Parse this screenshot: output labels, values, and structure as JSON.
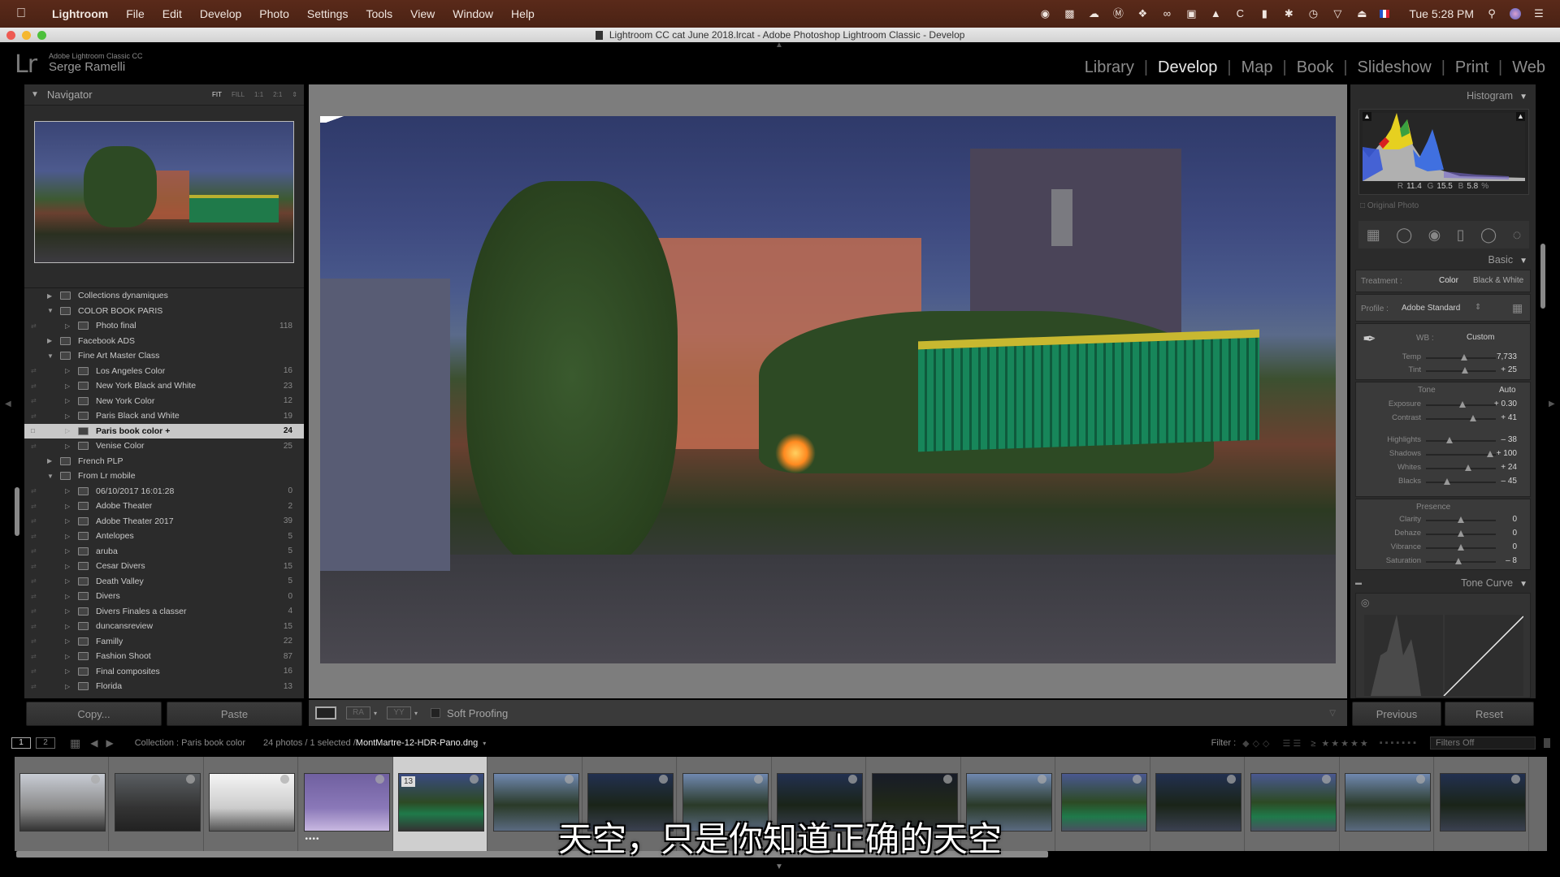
{
  "menubar": {
    "app_name": "Lightroom",
    "items": [
      "File",
      "Edit",
      "Develop",
      "Photo",
      "Settings",
      "Tools",
      "View",
      "Window",
      "Help"
    ],
    "clock": "Tue 5:28 PM",
    "status_icons": [
      "evernote-icon",
      "video-icon",
      "cloud-upload-icon",
      "1password-icon",
      "dropbox-icon",
      "creative-cloud-icon",
      "screen-icon",
      "flame-icon",
      "c-app-icon",
      "battery-icon",
      "bluetooth-icon",
      "time-machine-icon",
      "wifi-icon",
      "eject-icon",
      "flag-icon"
    ]
  },
  "window": {
    "title": "Lightroom CC cat June 2018.lrcat - Adobe Photoshop Lightroom Classic - Develop"
  },
  "identity": {
    "logo": "Lr",
    "product": "Adobe Lightroom Classic CC",
    "user": "Serge Ramelli"
  },
  "modules": {
    "items": [
      "Library",
      "Develop",
      "Map",
      "Book",
      "Slideshow",
      "Print",
      "Web"
    ],
    "active": "Develop"
  },
  "navigator": {
    "title": "Navigator",
    "zoom_options": [
      "FIT",
      "FILL",
      "1:1",
      "2:1"
    ],
    "selected_zoom": "FIT"
  },
  "collections": [
    {
      "name": "Collections dynamiques",
      "level": 0,
      "expanded": false,
      "count": ""
    },
    {
      "name": "COLOR BOOK PARIS",
      "level": 0,
      "expanded": true,
      "count": ""
    },
    {
      "name": "Photo final",
      "level": 1,
      "count": "118"
    },
    {
      "name": "Facebook ADS",
      "level": 0,
      "expanded": false,
      "count": ""
    },
    {
      "name": "Fine Art Master Class",
      "level": 0,
      "expanded": true,
      "count": ""
    },
    {
      "name": "Los Angeles Color",
      "level": 1,
      "count": "16"
    },
    {
      "name": "New York Black and White",
      "level": 1,
      "count": "23"
    },
    {
      "name": "New York Color",
      "level": 1,
      "count": "12"
    },
    {
      "name": "Paris Black and White",
      "level": 1,
      "count": "19"
    },
    {
      "name": "Paris book color  +",
      "level": 1,
      "count": "24",
      "selected": true
    },
    {
      "name": "Venise Color",
      "level": 1,
      "count": "25"
    },
    {
      "name": "French PLP",
      "level": 0,
      "expanded": false,
      "count": ""
    },
    {
      "name": "From Lr mobile",
      "level": 0,
      "expanded": true,
      "count": ""
    },
    {
      "name": "06/10/2017 16:01:28",
      "level": 1,
      "count": "0"
    },
    {
      "name": "Adobe Theater",
      "level": 1,
      "count": "2"
    },
    {
      "name": "Adobe Theater 2017",
      "level": 1,
      "count": "39"
    },
    {
      "name": "Antelopes",
      "level": 1,
      "count": "5"
    },
    {
      "name": "aruba",
      "level": 1,
      "count": "5"
    },
    {
      "name": "Cesar Divers",
      "level": 1,
      "count": "15"
    },
    {
      "name": "Death Valley",
      "level": 1,
      "count": "5"
    },
    {
      "name": "Divers",
      "level": 1,
      "count": "0"
    },
    {
      "name": "Divers Finales a classer",
      "level": 1,
      "count": "4"
    },
    {
      "name": "duncansreview",
      "level": 1,
      "count": "15"
    },
    {
      "name": "Familly",
      "level": 1,
      "count": "22"
    },
    {
      "name": "Fashion Shoot",
      "level": 1,
      "count": "87"
    },
    {
      "name": "Final composites",
      "level": 1,
      "count": "16"
    },
    {
      "name": "Florida",
      "level": 1,
      "count": "13"
    }
  ],
  "left_buttons": {
    "copy": "Copy...",
    "paste": "Paste"
  },
  "toolbar": {
    "soft_proofing": "Soft Proofing",
    "before_after_label": "RA",
    "yy_label": "YY"
  },
  "histogram": {
    "title": "Histogram",
    "r_label": "R",
    "r": "11.4",
    "g_label": "G",
    "g": "15.5",
    "b_label": "B",
    "b": "5.8",
    "pct": "%",
    "original_photo": "Original Photo"
  },
  "basic": {
    "title": "Basic",
    "treatment_label": "Treatment :",
    "treatment_options": [
      "Color",
      "Black & White"
    ],
    "treatment_selected": "Color",
    "profile_label": "Profile :",
    "profile": "Adobe Standard",
    "wb_label": "WB :",
    "wb": "Custom",
    "tone_label": "Tone",
    "auto_label": "Auto",
    "presence_label": "Presence",
    "wb_sliders": [
      {
        "label": "Temp",
        "value": "7,733",
        "pos": 0.55
      },
      {
        "label": "Tint",
        "value": "+ 25",
        "pos": 0.56
      }
    ],
    "tone_sliders": [
      {
        "label": "Exposure",
        "value": "+ 0.30",
        "pos": 0.52
      },
      {
        "label": "Contrast",
        "value": "+ 41",
        "pos": 0.68
      }
    ],
    "tone_sliders2": [
      {
        "label": "Highlights",
        "value": "– 38",
        "pos": 0.34
      },
      {
        "label": "Shadows",
        "value": "+ 100",
        "pos": 0.92
      },
      {
        "label": "Whites",
        "value": "+ 24",
        "pos": 0.6
      },
      {
        "label": "Blacks",
        "value": "– 45",
        "pos": 0.3
      }
    ],
    "presence_sliders": [
      {
        "label": "Clarity",
        "value": "0",
        "pos": 0.5
      },
      {
        "label": "Dehaze",
        "value": "0",
        "pos": 0.5
      },
      {
        "label": "Vibrance",
        "value": "0",
        "pos": 0.5
      },
      {
        "label": "Saturation",
        "value": "– 8",
        "pos": 0.46
      }
    ]
  },
  "tone_curve": {
    "title": "Tone Curve"
  },
  "right_buttons": {
    "previous": "Previous",
    "reset": "Reset"
  },
  "filmstrip": {
    "screens": [
      "1",
      "2"
    ],
    "source": "Collection : Paris book color",
    "count": "24 photos / 1 selected /",
    "filename": "MontMartre-12-HDR-Pano.dng",
    "filter_label": "Filter :",
    "filters_off": "Filters Off",
    "selected_index_badge": "13",
    "thumbs": [
      {
        "kind": "eiffel-light"
      },
      {
        "kind": "eiffel-dark"
      },
      {
        "kind": "eiffel-bright"
      },
      {
        "kind": "eiffel-snow",
        "rating": "••••"
      },
      {
        "kind": "montmartre",
        "selected": true
      },
      {
        "kind": "street"
      },
      {
        "kind": "street-dark"
      },
      {
        "kind": "street"
      },
      {
        "kind": "street-dark"
      },
      {
        "kind": "street-night"
      },
      {
        "kind": "street"
      },
      {
        "kind": "street-green"
      },
      {
        "kind": "street-dark"
      },
      {
        "kind": "street-green"
      },
      {
        "kind": "street"
      },
      {
        "kind": "street-dark"
      }
    ]
  },
  "subtitle": "天空，只是你知道正确的天空"
}
